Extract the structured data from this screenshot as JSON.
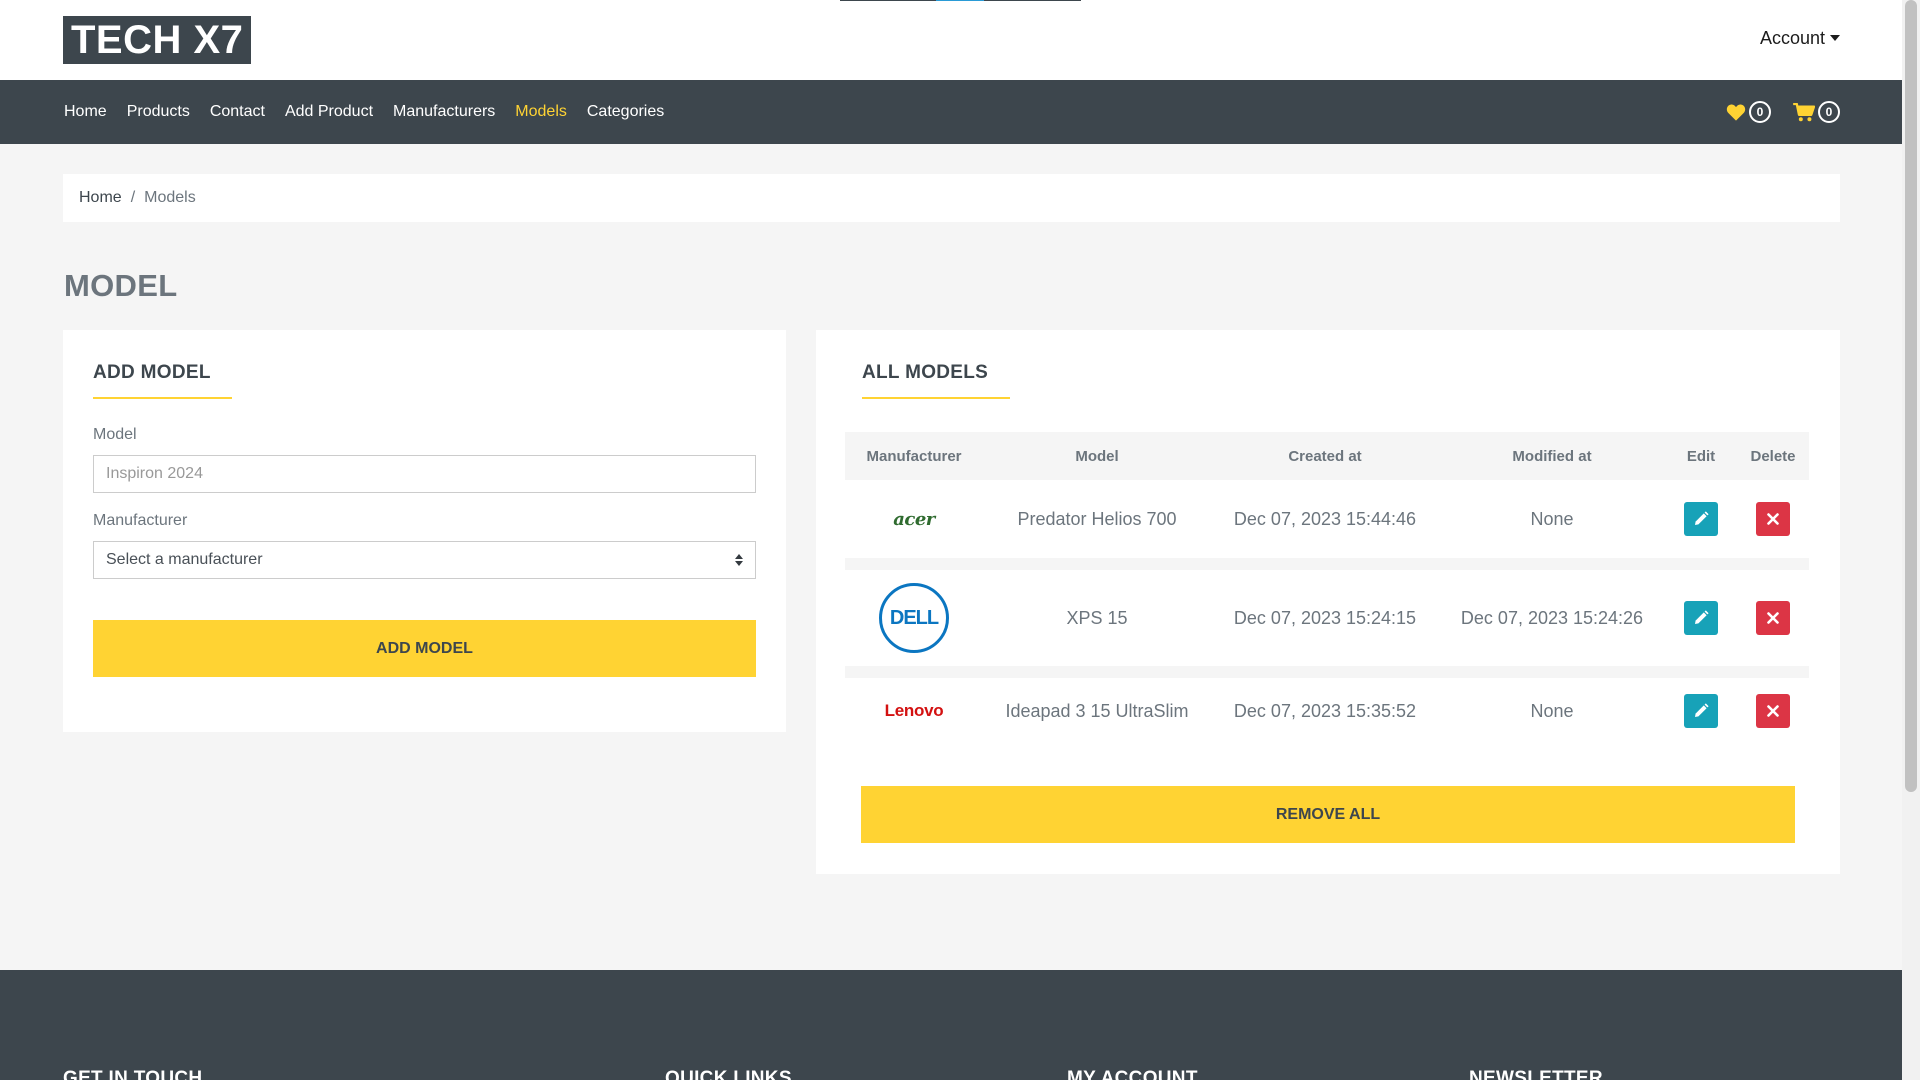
{
  "header": {
    "logo_text": "TECH X7",
    "account_label": "Account"
  },
  "nav": {
    "items": [
      {
        "label": "Home"
      },
      {
        "label": "Products"
      },
      {
        "label": "Contact"
      },
      {
        "label": "Add Product"
      },
      {
        "label": "Manufacturers"
      },
      {
        "label": "Models",
        "active": true
      },
      {
        "label": "Categories"
      }
    ],
    "wishlist_count": "0",
    "cart_count": "0",
    "accent_color": "#ffd333"
  },
  "breadcrumb": {
    "home": "Home",
    "separator": "/",
    "current": "Models"
  },
  "page_title": "MODEL",
  "add_model": {
    "title": "ADD MODEL",
    "model_label": "Model",
    "model_placeholder": "Inspiron 2024",
    "manufacturer_label": "Manufacturer",
    "manufacturer_selected": "Select a manufacturer",
    "submit_label": "ADD MODEL"
  },
  "all_models": {
    "title": "ALL MODELS",
    "columns": [
      "Manufacturer",
      "Model",
      "Created at",
      "Modified at",
      "Edit",
      "Delete"
    ],
    "rows": [
      {
        "manufacturer_logo": "acer",
        "model": "Predator Helios 700",
        "created_at": "Dec 07, 2023 15:44:46",
        "modified_at": "None"
      },
      {
        "manufacturer_logo": "DELL",
        "model": "XPS 15",
        "created_at": "Dec 07, 2023 15:24:15",
        "modified_at": "Dec 07, 2023 15:24:26"
      },
      {
        "manufacturer_logo": "Lenovo",
        "model": "Ideapad 3 15 UltraSlim",
        "created_at": "Dec 07, 2023 15:35:52",
        "modified_at": "None"
      }
    ],
    "remove_all_label": "REMOVE ALL"
  },
  "footer": {
    "sections": [
      "GET IN TOUCH",
      "QUICK LINKS",
      "MY ACCOUNT",
      "NEWSLETTER"
    ]
  },
  "colors": {
    "dark": "#3d464d",
    "yellow": "#ffd333",
    "edit": "#17a2b8",
    "delete": "#dc3545"
  }
}
